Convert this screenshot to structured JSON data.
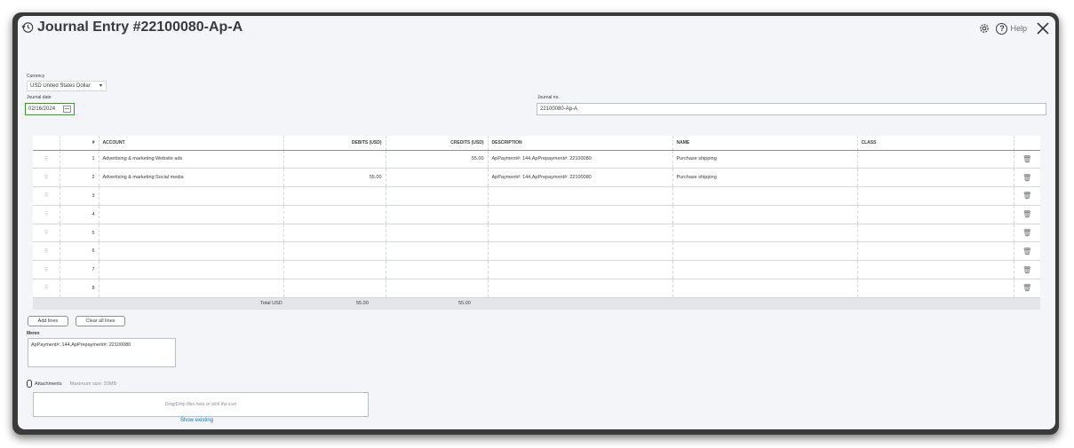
{
  "header": {
    "title": "Journal Entry #22100080-Ap-A",
    "help_label": "Help"
  },
  "form": {
    "currency_label": "Currency",
    "currency_value": "USD United States Dollar",
    "date_label": "Journal date",
    "date_value": "02/16/2024",
    "journal_no_label": "Journal no.",
    "journal_no_value": "22100080-Ap-A"
  },
  "table": {
    "headers": {
      "num": "#",
      "account": "ACCOUNT",
      "debits": "DEBITS (USD)",
      "credits": "CREDITS (USD)",
      "description": "DESCRIPTION",
      "name": "NAME",
      "class": "CLASS"
    },
    "rows": [
      {
        "num": "1",
        "account": "Advertising & marketing:Website ads",
        "debit": "",
        "credit": "55.00",
        "description": "ApPayment#: 144,ApPrepayment#: 22100080",
        "name": "Purchase shipping",
        "class": ""
      },
      {
        "num": "2",
        "account": "Advertising & marketing:Social media",
        "debit": "55.00",
        "credit": "",
        "description": "ApPayment#: 144,ApPrepayment#: 22100080",
        "name": "Purchase shipping",
        "class": ""
      },
      {
        "num": "3",
        "account": "",
        "debit": "",
        "credit": "",
        "description": "",
        "name": "",
        "class": ""
      },
      {
        "num": "4",
        "account": "",
        "debit": "",
        "credit": "",
        "description": "",
        "name": "",
        "class": ""
      },
      {
        "num": "5",
        "account": "",
        "debit": "",
        "credit": "",
        "description": "",
        "name": "",
        "class": ""
      },
      {
        "num": "6",
        "account": "",
        "debit": "",
        "credit": "",
        "description": "",
        "name": "",
        "class": ""
      },
      {
        "num": "7",
        "account": "",
        "debit": "",
        "credit": "",
        "description": "",
        "name": "",
        "class": ""
      },
      {
        "num": "8",
        "account": "",
        "debit": "",
        "credit": "",
        "description": "",
        "name": "",
        "class": ""
      }
    ],
    "total_label": "Total USD",
    "total_debits": "55.00",
    "total_credits": "55.00"
  },
  "actions": {
    "add_lines": "Add lines",
    "clear_all_lines": "Clear all lines"
  },
  "memo": {
    "label": "Memo",
    "value": "ApPayment#: 144,ApPrepayment#: 22100080"
  },
  "attachments": {
    "label": "Attachments",
    "max_size": "Maximum size: 20MB",
    "drop_text": "Drag/Drop files here or click the icon",
    "show_existing": "Show existing"
  },
  "icons": [
    "history-icon",
    "gear-icon",
    "help-icon",
    "close-icon",
    "calendar-icon",
    "drag-handle-icon",
    "trash-icon",
    "paperclip-icon"
  ]
}
